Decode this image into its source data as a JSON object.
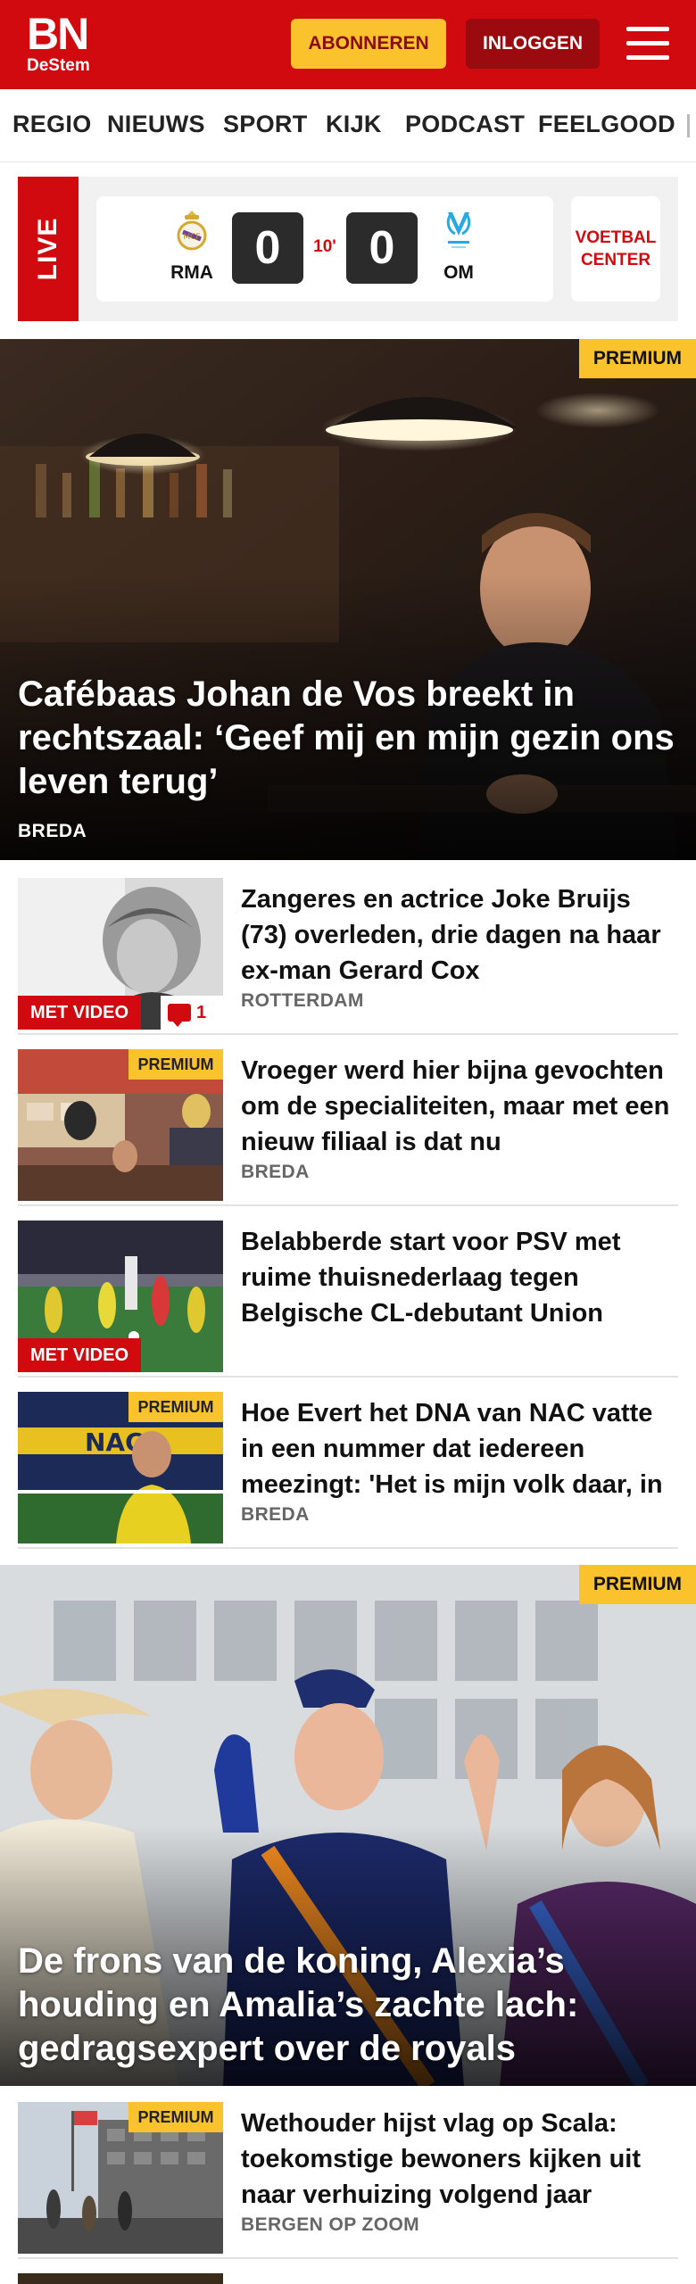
{
  "header": {
    "logo_main": "BN",
    "logo_sub": "DeStem",
    "subscribe_label": "ABONNEREN",
    "login_label": "INLOGGEN",
    "brand_color": "#d10a10",
    "accent_color": "#fac32d"
  },
  "nav": {
    "items": [
      "REGIO",
      "NIEUWS",
      "SPORT",
      "KIJK",
      "PODCAST",
      "FEELGOOD"
    ]
  },
  "live": {
    "label": "LIVE",
    "home_team": "RMA",
    "away_team": "OM",
    "home_score": "0",
    "away_score": "0",
    "minute": "10'",
    "center_label_1": "VOETBAL",
    "center_label_2": "CENTER"
  },
  "badges": {
    "premium": "PREMIUM",
    "video": "MET VIDEO"
  },
  "hero1": {
    "title": "Cafébaas Johan de Vos breekt in rechtszaal: ‘Geef mij en mijn gezin ons leven terug’",
    "location": "BREDA"
  },
  "articles": [
    {
      "title": "Zangeres en actrice Joke Bruijs (73) overleden, drie dagen na haar ex-man Gerard Cox",
      "location": "ROTTERDAM",
      "comments": "1"
    },
    {
      "title": "Vroeger werd hier bijna gevochten om de specialiteiten, maar met een nieuw filiaal is dat nu",
      "location": "BREDA"
    },
    {
      "title": "Belabberde start voor PSV met ruime thuisnederlaag tegen Belgische CL-debutant Union",
      "location": ""
    },
    {
      "title": "Hoe Evert het DNA van NAC vatte in een nummer dat iedereen meezingt: 'Het is mijn volk daar, in",
      "location": "BREDA"
    }
  ],
  "hero2": {
    "title": "De frons van de koning, Alexia’s houding en Amalia’s zachte lach: gedragsexpert over de royals"
  },
  "article5": {
    "title": "Wethouder hijst vlag op Scala: toekomstige bewoners kijken uit naar verhuizing volgend jaar",
    "location": "BERGEN OP ZOOM"
  }
}
